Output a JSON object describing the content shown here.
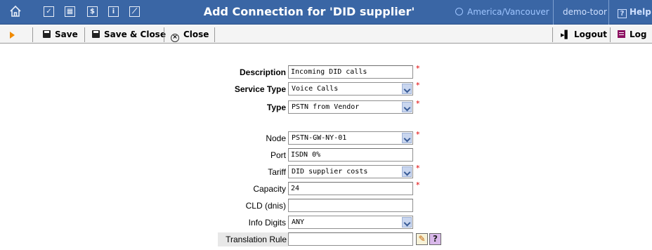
{
  "header": {
    "title": "Add Connection for 'DID supplier'",
    "timezone": "America/Vancouver",
    "user": "demo-toor",
    "help_label": "Help",
    "nav_icons": [
      "home-icon",
      "checkbox-icon",
      "grid-icon",
      "dollar-icon",
      "info-icon",
      "chart-icon"
    ]
  },
  "toolbar": {
    "save_label": "Save",
    "save_close_label": "Save & Close",
    "close_label": "Close",
    "logout_label": "Logout",
    "log_label": "Log"
  },
  "form": {
    "description": {
      "label": "Description",
      "value": "Incoming DID calls",
      "required": true
    },
    "service_type": {
      "label": "Service Type",
      "value": "Voice Calls",
      "required": true
    },
    "type": {
      "label": "Type",
      "value": "PSTN from Vendor",
      "required": true
    },
    "node": {
      "label": "Node",
      "value": "PSTN-GW-NY-01",
      "required": true
    },
    "port": {
      "label": "Port",
      "value": "ISDN 0%"
    },
    "tariff": {
      "label": "Tariff",
      "value": "DID supplier costs",
      "required": true
    },
    "capacity": {
      "label": "Capacity",
      "value": "24",
      "required": true
    },
    "cld": {
      "label": "CLD (dnis)",
      "value": ""
    },
    "info_digits": {
      "label": "Info Digits",
      "value": "ANY"
    },
    "translation_rule": {
      "label": "Translation Rule",
      "value": ""
    },
    "required_mark": "*"
  },
  "colors": {
    "header_bg": "#3a66a5",
    "toolbar_bg": "#f4f4f4",
    "required": "#e00000"
  }
}
